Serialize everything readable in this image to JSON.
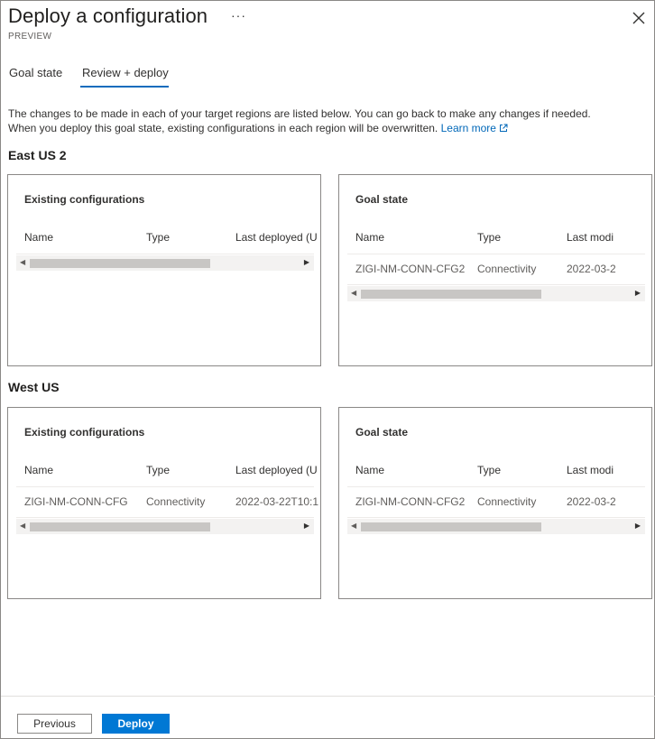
{
  "window": {
    "title": "Deploy a configuration",
    "more_label": "···",
    "subtitle": "PREVIEW"
  },
  "tabs": [
    {
      "label": "Goal state"
    },
    {
      "label": "Review + deploy"
    }
  ],
  "description": {
    "line1": "The changes to be made in each of your target regions are listed below. You can go back to make any changes if needed.",
    "line2": "When you deploy this goal state, existing configurations in each region will be overwritten.",
    "link": "Learn more"
  },
  "regions": [
    {
      "name": "East US 2",
      "existing": {
        "title": "Existing configurations",
        "columns": [
          "Name",
          "Type",
          "Last deployed (U"
        ],
        "rows": []
      },
      "goal": {
        "title": "Goal state",
        "columns": [
          "Name",
          "Type",
          "Last modi"
        ],
        "rows": [
          [
            "ZIGI-NM-CONN-CFG2",
            "Connectivity",
            "2022-03-2"
          ]
        ]
      }
    },
    {
      "name": "West US",
      "existing": {
        "title": "Existing configurations",
        "columns": [
          "Name",
          "Type",
          "Last deployed (U"
        ],
        "rows": [
          [
            "ZIGI-NM-CONN-CFG",
            "Connectivity",
            "2022-03-22T10:1"
          ]
        ]
      },
      "goal": {
        "title": "Goal state",
        "columns": [
          "Name",
          "Type",
          "Last modi"
        ],
        "rows": [
          [
            "ZIGI-NM-CONN-CFG2",
            "Connectivity",
            "2022-03-2"
          ]
        ]
      }
    }
  ],
  "footer": {
    "previous_label": "Previous",
    "deploy_label": "Deploy"
  },
  "colors": {
    "accent": "#0078d4",
    "link": "#0067b8",
    "tab_underline": "#0f6cbd"
  }
}
